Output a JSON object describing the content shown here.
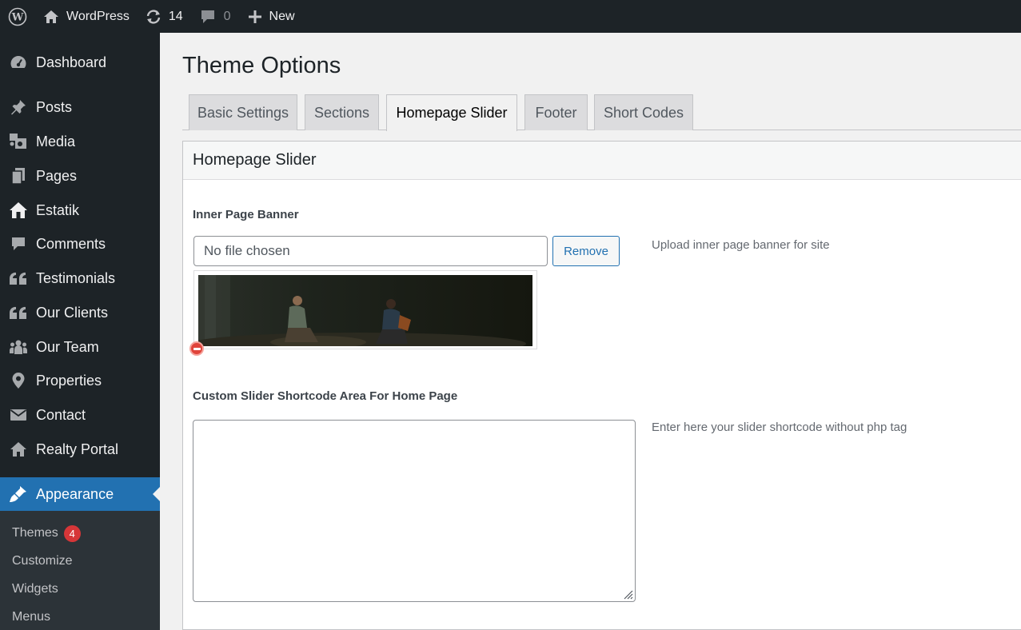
{
  "adminbar": {
    "site_name": "WordPress",
    "updates_count": "14",
    "comments_count": "0",
    "new_label": "New"
  },
  "sidebar": {
    "items": [
      {
        "label": "Dashboard",
        "icon": "dashboard-icon"
      },
      {
        "label": "Posts",
        "icon": "pin-icon"
      },
      {
        "label": "Media",
        "icon": "media-icon"
      },
      {
        "label": "Pages",
        "icon": "pages-icon"
      },
      {
        "label": "Estatik",
        "icon": "house-icon"
      },
      {
        "label": "Comments",
        "icon": "comment-icon"
      },
      {
        "label": "Testimonials",
        "icon": "quote-icon"
      },
      {
        "label": "Our Clients",
        "icon": "quote-icon"
      },
      {
        "label": "Our Team",
        "icon": "groups-icon"
      },
      {
        "label": "Properties",
        "icon": "location-icon"
      },
      {
        "label": "Contact",
        "icon": "email-icon"
      },
      {
        "label": "Realty Portal",
        "icon": "house-icon"
      },
      {
        "label": "Appearance",
        "icon": "brush-icon"
      }
    ],
    "submenu": [
      {
        "label": "Themes",
        "badge": "4"
      },
      {
        "label": "Customize"
      },
      {
        "label": "Widgets"
      },
      {
        "label": "Menus"
      }
    ]
  },
  "page": {
    "title": "Theme Options",
    "tabs": [
      "Basic Settings",
      "Sections",
      "Homepage Slider",
      "Footer",
      "Short Codes"
    ],
    "active_tab": "Homepage Slider"
  },
  "panel": {
    "heading": "Homepage Slider",
    "banner": {
      "label": "Inner Page Banner",
      "file_text": "No file chosen",
      "remove_label": "Remove",
      "help": "Upload inner page banner for site"
    },
    "shortcode": {
      "label": "Custom Slider Shortcode Area For Home Page",
      "value": "",
      "help": "Enter here your slider shortcode without php tag"
    }
  },
  "colors": {
    "admin_dark": "#1d2327",
    "accent_blue": "#2271b1",
    "badge_red": "#d63638"
  }
}
